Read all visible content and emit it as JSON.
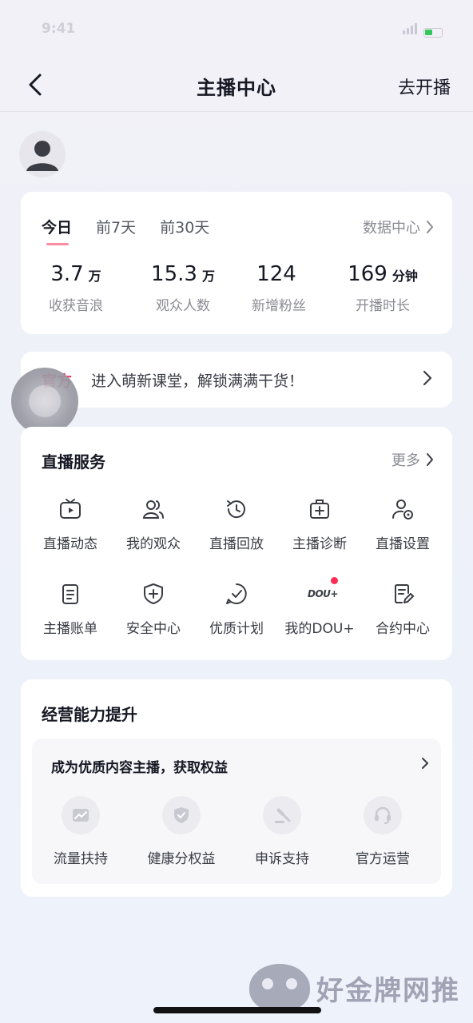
{
  "status": {
    "time": "9:41"
  },
  "nav": {
    "title": "主播中心",
    "right_action": "去开播"
  },
  "stats": {
    "tabs": [
      "今日",
      "前7天",
      "前30天"
    ],
    "data_center": "数据中心",
    "items": [
      {
        "value": "3.7",
        "unit": "万",
        "label": "收获音浪"
      },
      {
        "value": "15.3",
        "unit": "万",
        "label": "观众人数"
      },
      {
        "value": "124",
        "unit": "",
        "label": "新增粉丝"
      },
      {
        "value": "169",
        "unit": "分钟",
        "label": "开播时长"
      }
    ]
  },
  "notice": {
    "tag": "官方",
    "text": "进入萌新课堂，解锁满满干货！"
  },
  "services": {
    "title": "直播服务",
    "more": "更多",
    "items": [
      {
        "label": "直播动态",
        "icon": "tv-icon"
      },
      {
        "label": "我的观众",
        "icon": "users-icon"
      },
      {
        "label": "直播回放",
        "icon": "history-icon"
      },
      {
        "label": "主播诊断",
        "icon": "medical-kit-icon"
      },
      {
        "label": "直播设置",
        "icon": "user-settings-icon"
      },
      {
        "label": "主播账单",
        "icon": "bill-icon"
      },
      {
        "label": "安全中心",
        "icon": "shield-plus-icon"
      },
      {
        "label": "优质计划",
        "icon": "check-circle-icon"
      },
      {
        "label": "我的DOU+",
        "icon": "dou-icon",
        "icon_text": "DOU+"
      },
      {
        "label": "合约中心",
        "icon": "contract-edit-icon"
      }
    ]
  },
  "business": {
    "title": "经营能力提升",
    "subtitle": "成为优质内容主播，获取权益",
    "items": [
      {
        "label": "流量扶持",
        "icon": "traffic-chart-icon"
      },
      {
        "label": "健康分权益",
        "icon": "health-shield-icon"
      },
      {
        "label": "申诉支持",
        "icon": "gavel-icon"
      },
      {
        "label": "官方运营",
        "icon": "headset-icon"
      }
    ]
  },
  "watermark": {
    "text": "好金牌网推"
  },
  "colors": {
    "accent": "#fe2c55",
    "text": "#161823",
    "secondary": "#8a8b93"
  }
}
